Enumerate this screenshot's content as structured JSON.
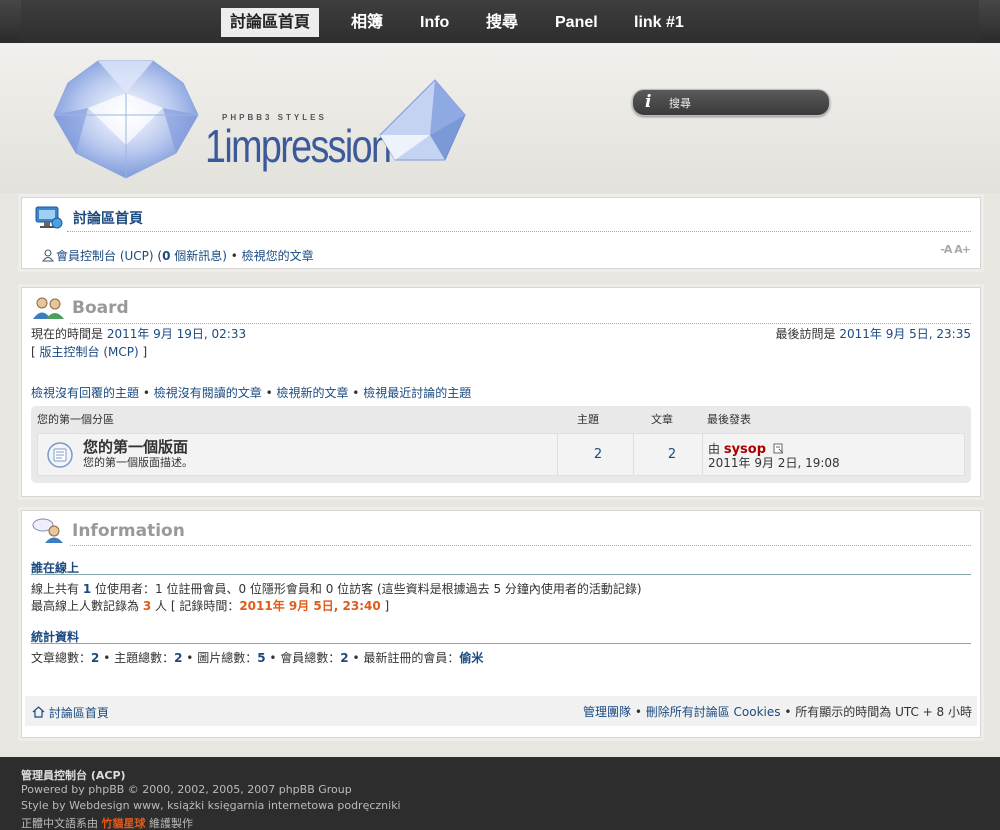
{
  "nav": {
    "items": [
      {
        "label": "討論區首頁",
        "active": true
      },
      {
        "label": "相簿"
      },
      {
        "label": "Info"
      },
      {
        "label": "搜尋"
      },
      {
        "label": "Panel"
      },
      {
        "label": "link #1"
      }
    ]
  },
  "header": {
    "logo_small": "PHPBB3 STYLES",
    "logo_brand": "1impression",
    "search_placeholder": "搜尋",
    "search_icon": "i"
  },
  "breadcrumb_panel": {
    "title": "討論區首頁",
    "ucp_label": "會員控制台 (UCP)",
    "messages_open": " (",
    "new_messages_count": "0",
    "new_messages_label": " 個新訊息)",
    "view_posts": "檢視您的文章",
    "font_size_toggle": "-A A+"
  },
  "board": {
    "title": "Board",
    "current_time_label": "現在的時間是 ",
    "current_time": "2011年 9月 19日, 02:33",
    "last_visit_label": "最後訪問是 ",
    "last_visit": "2011年 9月 5日, 23:35",
    "mcp": "版主控制台 (MCP)",
    "quick_links": [
      "檢視沒有回覆的主題",
      "檢視沒有閱讀的文章",
      "檢視新的文章",
      "檢視最近討論的主題"
    ],
    "category": "您的第一個分區",
    "col_topics": "主題",
    "col_posts": "文章",
    "col_last": "最後發表",
    "forum": {
      "name": "您的第一個版面",
      "desc": "您的第一個版面描述。",
      "topics": "2",
      "posts": "2",
      "last_by_label": "由 ",
      "last_user": "sysop",
      "last_time": "2011年 9月 2日, 19:08"
    }
  },
  "information": {
    "title": "Information",
    "online_heading": "誰在線上",
    "online_text_a": "線上共有 ",
    "online_total": "1",
    "online_text_b": " 位使用者：1 位註冊會員、0 位隱形會員和 0 位訪客 (這些資料是根據過去 5 分鐘內使用者的活動記錄)",
    "record_text_a": "最高線上人數記錄為 ",
    "record_count": "3",
    "record_text_b": " 人 [ 記錄時間：",
    "record_time": "2011年 9月 5日, 23:40",
    "record_text_c": " ]",
    "stats_heading": "統計資料",
    "stats_posts_label": "文章總數：",
    "stats_posts": "2",
    "stats_topics_label": "主題總數：",
    "stats_topics": "2",
    "stats_images_label": "圖片總數：",
    "stats_images": "5",
    "stats_members_label": "會員總數：",
    "stats_members": "2",
    "stats_newest_label": "最新註冊的會員：",
    "stats_newest": "偷米"
  },
  "footer_bar": {
    "home": "討論區首頁",
    "team": "管理團隊",
    "delete_cookies": "刪除所有討論區 Cookies",
    "timezone": "所有顯示的時間為 UTC + 8 小時"
  },
  "footer": {
    "acp": "管理員控制台 (ACP)",
    "powered": "Powered by phpBB © 2000, 2002, 2005, 2007 phpBB Group",
    "style": "Style by Webdesign www, książki księgarnia internetowa podręczniki",
    "trans_a": "正體中文語系由 ",
    "trans_hl": "竹貓星球",
    "trans_b": " 維護製作"
  },
  "colors": {
    "link": "#1a4a80",
    "accent": "#e25a1a",
    "username": "#aa0000"
  }
}
